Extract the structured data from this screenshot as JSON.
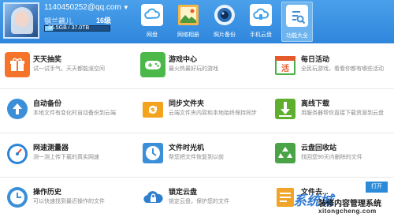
{
  "user": {
    "id": "1140450252@qq.com",
    "nickname": "钢兰藕儿",
    "level": "16级",
    "quota_text": "36.5GB / 37.0TB",
    "quota_fraction": 0.12
  },
  "nav": [
    {
      "label": "网盘",
      "icon": "cloud-icon",
      "color": "#ffffff"
    },
    {
      "label": "网络相册",
      "icon": "photo-album-icon",
      "color": "#f4b64a"
    },
    {
      "label": "照片备份",
      "icon": "camera-icon",
      "color": "#2a6db6"
    },
    {
      "label": "手机云盘",
      "icon": "phone-cloud-icon",
      "color": "#ffffff"
    },
    {
      "label": "功能大全",
      "icon": "features-icon",
      "color": "#ffffff"
    }
  ],
  "features": [
    {
      "title": "天天抽奖",
      "desc": "试一试手气，天天都能涨空间",
      "icon": "gift-icon",
      "color": "#f5742a"
    },
    {
      "title": "游戏中心",
      "desc": "最火热最好玩的游戏",
      "icon": "gamepad-icon",
      "color": "#4cb84a"
    },
    {
      "title": "每日活动",
      "desc": "全民玩游戏，看看你都有哪些活动",
      "icon": "calendar-icon",
      "color": "#e45a2a"
    },
    {
      "title": "自动备份",
      "desc": "本地文件有变化时自动备份到云端",
      "icon": "upload-icon",
      "color": "#3a8fd8"
    },
    {
      "title": "同步文件夹",
      "desc": "云端文件夹内容和本地始终保持同步",
      "icon": "sync-icon",
      "color": "#f3a31d"
    },
    {
      "title": "离线下载",
      "desc": "用服务器帮你直接下载资源到云盘",
      "icon": "download-icon",
      "color": "#5fae2e"
    },
    {
      "title": "网速测量器",
      "desc": "测一测上传下载的真实网速",
      "icon": "speedometer-icon",
      "color": "#2d84d4"
    },
    {
      "title": "文件时光机",
      "desc": "帮您把文件恢复到以前",
      "icon": "clock-icon",
      "color": "#3a8fd8"
    },
    {
      "title": "云盘回收站",
      "desc": "找回您90天内删除的文件",
      "icon": "recycle-icon",
      "color": "#4aa446"
    },
    {
      "title": "操作历史",
      "desc": "可以快速找到最近操作的文件",
      "icon": "history-icon",
      "color": "#3a8fd8"
    },
    {
      "title": "锁定云盘",
      "desc": "锁定云盘，保护您的文件",
      "icon": "lock-cloud-icon",
      "color": "#2f7fcf"
    },
    {
      "title": "文件去...",
      "desc": "",
      "icon": "file-icon",
      "color": "#f0a52a"
    }
  ],
  "open_button": "打开",
  "watermark": {
    "logo": "系统城",
    "line1": "装修内容管理系统",
    "line2": "xitongcheng.com"
  }
}
